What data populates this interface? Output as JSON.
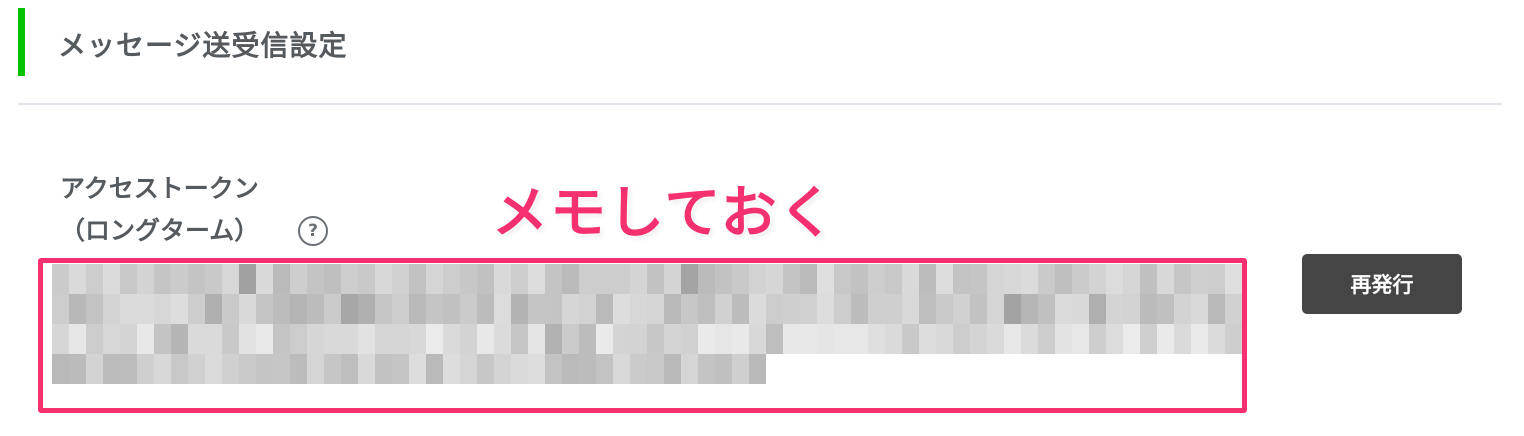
{
  "section": {
    "title": "メッセージ送受信設定",
    "accent_color": "#00c300"
  },
  "access_token": {
    "label_line1": "アクセストークン",
    "label_line2": "（ロングターム）",
    "help_icon": "question-circle-icon",
    "help_symbol": "?",
    "value_state": "blurred"
  },
  "annotation": {
    "text": "メモしておく",
    "color": "#f5306e"
  },
  "actions": {
    "reissue_label": "再発行",
    "reissue_bg": "#454545"
  }
}
